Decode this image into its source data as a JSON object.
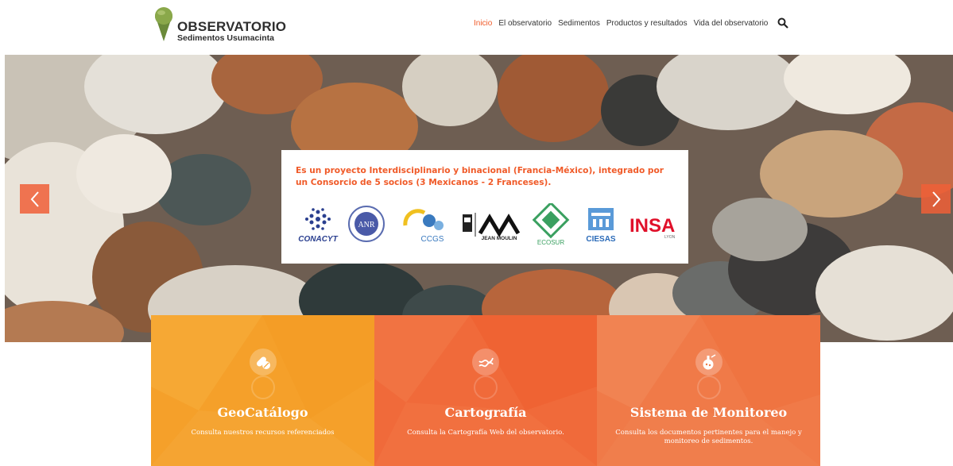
{
  "header": {
    "logo_title": "OBSERVATORIO",
    "logo_subtitle": "Sedimentos Usumacinta",
    "nav": [
      {
        "label": "Inicio",
        "active": true
      },
      {
        "label": "El observatorio",
        "active": false
      },
      {
        "label": "Sedimentos",
        "active": false
      },
      {
        "label": "Productos y resultados",
        "active": false
      },
      {
        "label": "Vida del observatorio",
        "active": false
      }
    ],
    "search_icon": "search-icon"
  },
  "hero": {
    "text": "Es un proyecto Interdisciplinario y binacional (Francia-México), integrado por un Consorcio de 5 socios (3 Mexicanos - 2 Franceses).",
    "partner_logos": [
      "CONACYT",
      "ANR",
      "CCGS",
      "JEAN MOULIN",
      "ECOSUR",
      "CIESAS",
      "INSA"
    ],
    "prev_icon": "chevron-left-icon",
    "next_icon": "chevron-right-icon"
  },
  "cards": [
    {
      "title": "GeoCatálogo",
      "desc": "Consulta nuestros recursos referenciados",
      "icon": "pill-icon"
    },
    {
      "title": "Cartografía",
      "desc": "Consulta la Cartografía Web del observatorio.",
      "icon": "dna-icon"
    },
    {
      "title": "Sistema de Monitoreo",
      "desc": "Consulta los documentos pertinentes para el manejo y monitoreo de sedimentos.",
      "icon": "flask-icon"
    }
  ],
  "colors": {
    "accent": "#f05a28",
    "card1": "#f5a02a",
    "card2": "#f06a3a",
    "card3": "#f07a48"
  }
}
